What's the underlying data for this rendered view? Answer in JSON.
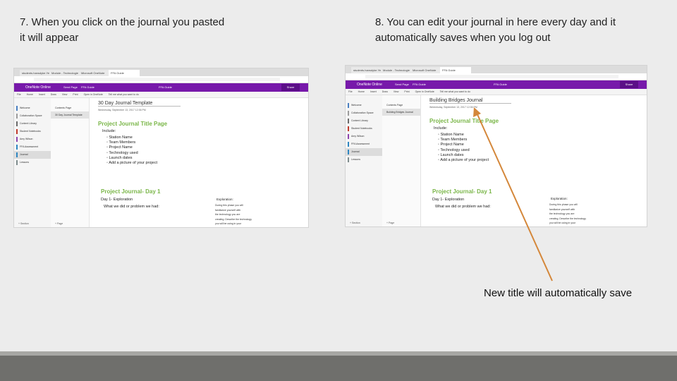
{
  "captions": {
    "left": "7. When you click on the journal you pasted\nit will appear",
    "right": "8. You can edit your journal in here every day and it\n    automatically saves when you log out",
    "note": "New title will automatically save"
  },
  "colors": {
    "onenote_purple": "#7719aa",
    "heading_green": "#7ab648",
    "arrow": "#d4873a"
  },
  "left_shot": {
    "tabs": [
      "students.hansdyke.Yea",
      "Module - Technologie",
      "Microsoft OneNote",
      "FFA Guide"
    ],
    "app_name": "OneNote Online",
    "crumbs": [
      "Send Page",
      "FFA Guide"
    ],
    "share": "Share",
    "menu": [
      "File",
      "Home",
      "Insert",
      "Draw",
      "View",
      "Print",
      "Open in OneNote",
      "Tell me what you want to do"
    ],
    "sections": [
      "Welcome",
      "Collaboration Space",
      "Content Library",
      "Student Notebooks",
      "Amy Wilson",
      "FFA Assessment",
      "Journal",
      "Lessons"
    ],
    "pages": [
      "Contents Page",
      "30 Day Journal Template"
    ],
    "page_title": "30 Day Journal Template",
    "page_date": "Wednesday, September 13, 2017   12:36 PM",
    "heading": "Project Journal Title Page",
    "includes": "Include:",
    "items": [
      "Station Name",
      "Team Members",
      "Project Name",
      "Technology used",
      "Launch dates",
      "Add a picture of your project"
    ],
    "day_heading": "Project Journal- Day 1",
    "day_label": "Day 1- Exploration",
    "day_bullet": "What we did or problem we had:",
    "explore_title": "Exploration:",
    "explore_text": "During this phase you will\nfamiliarize yourself with\nthe technology you are\ncreating. Describe the technology\nyou will be using in your",
    "foot_section": "+ Section",
    "foot_page": "+ Page"
  },
  "right_shot": {
    "tabs": [
      "students.hansdyke.Yea",
      "Module - Technologie",
      "Microsoft OneNote",
      "FFA Guide"
    ],
    "app_name": "OneNote Online",
    "crumbs": [
      "Send Page",
      "FFA Guide"
    ],
    "share": "Share",
    "menu": [
      "File",
      "Home",
      "Insert",
      "Draw",
      "View",
      "Print",
      "Open in OneNote",
      "Tell me what you want to do"
    ],
    "sections": [
      "Welcome",
      "Collaboration Space",
      "Content Library",
      "Student Notebooks",
      "Amy Wilson",
      "FFA Assessment",
      "Journal",
      "Lessons"
    ],
    "pages": [
      "Contents Page",
      "Building Bridges Journal"
    ],
    "page_title": "Building Bridges Journal",
    "page_date": "Wednesday, September 13, 2017   12:36 PM",
    "heading": "Project Journal Title Page",
    "includes": "Include:",
    "items": [
      "Station Name",
      "Team Members",
      "Project Name",
      "Technology used",
      "Launch dates",
      "Add a picture of your project"
    ],
    "day_heading": "Project Journal- Day 1",
    "day_label": "Day 1- Exploration",
    "day_bullet": "What we did or problem we had:",
    "explore_title": "Exploration:",
    "explore_text": "During this phase you will\nfamiliarize yourself with\nthe technology you are\ncreating. Describe the technology\nyou will be using in your",
    "foot_section": "+ Section",
    "foot_page": "+ Page"
  }
}
